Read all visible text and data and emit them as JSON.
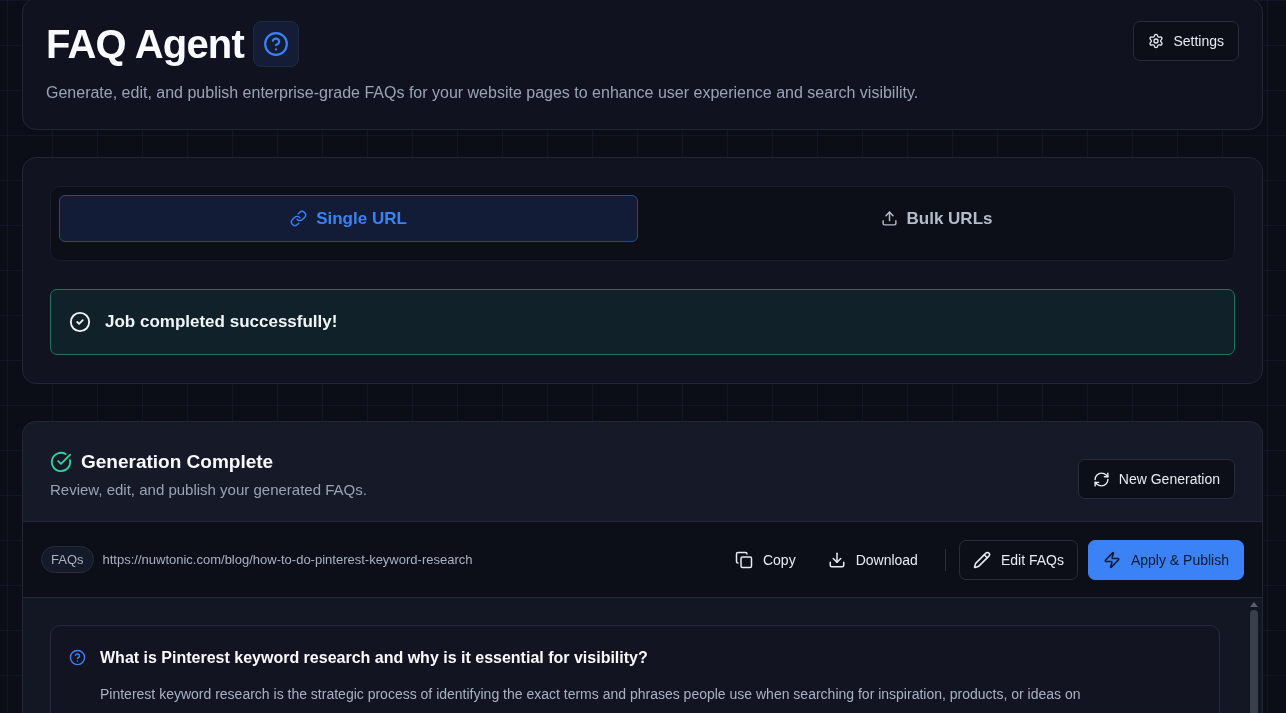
{
  "header": {
    "title": "FAQ Agent",
    "subtitle": "Generate, edit, and publish enterprise-grade FAQs for your website pages to enhance user experience and search visibility.",
    "settings_button": "Settings"
  },
  "mode_tabs": [
    {
      "label": "Single URL",
      "selected": true
    },
    {
      "label": "Bulk URLs",
      "selected": false
    }
  ],
  "status_alert": {
    "message": "Job completed successfully!"
  },
  "result": {
    "title": "Generation Complete",
    "subtitle": "Review, edit, and publish your generated FAQs.",
    "new_generation_button": "New Generation",
    "badge": "FAQs",
    "url": "https://nuwtonic.com/blog/how-to-do-pinterest-keyword-research",
    "actions": [
      {
        "label": "Copy",
        "kind": "ghost"
      },
      {
        "label": "Download",
        "kind": "ghost"
      },
      {
        "label": "Edit FAQs",
        "kind": "outline"
      },
      {
        "label": "Apply & Publish",
        "kind": "primary"
      }
    ],
    "faqs": [
      {
        "question": "What is Pinterest keyword research and why is it essential for visibility?",
        "answer": "Pinterest keyword research is the strategic process of identifying the exact terms and phrases people use when searching for inspiration, products, or ideas on"
      }
    ]
  }
}
